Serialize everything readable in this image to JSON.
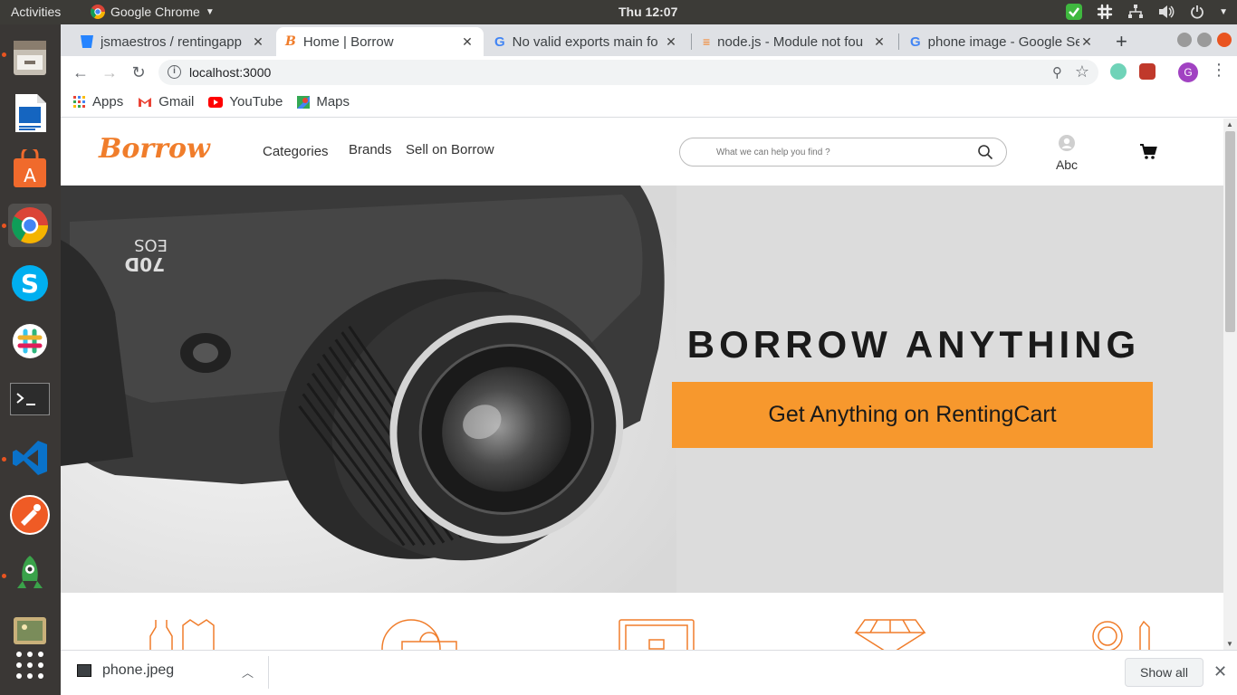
{
  "system": {
    "activities": "Activities",
    "app_name": "Google Chrome",
    "clock": "Thu 12:07"
  },
  "tabs": [
    {
      "title": "jsmaestros / rentingapp",
      "active": false
    },
    {
      "title": "Home | Borrow",
      "active": true
    },
    {
      "title": "No valid exports main fo",
      "active": false
    },
    {
      "title": "node.js - Module not fou",
      "active": false
    },
    {
      "title": "phone image - Google Se",
      "active": false
    }
  ],
  "toolbar": {
    "url": "localhost:3000"
  },
  "bookmarks": [
    {
      "label": "Apps",
      "icon": "apps-grid-icon"
    },
    {
      "label": "Gmail",
      "icon": "gmail-icon"
    },
    {
      "label": "YouTube",
      "icon": "youtube-icon"
    },
    {
      "label": "Maps",
      "icon": "maps-icon"
    }
  ],
  "site": {
    "logo": "Borrow",
    "nav": [
      "Categories",
      "Brands",
      "Sell on Borrow"
    ],
    "search_placeholder": "What we can help you find ?",
    "user_name": "Abc",
    "hero_title": "BORROW ANYTHING",
    "cta_label": "Get Anything on RentingCart",
    "brand_color": "#f07d2b",
    "cta_color": "#f7982d"
  },
  "camera_text": {
    "model_line1": "EOS",
    "model_line2": "70D"
  },
  "downloads": {
    "file_name": "phone.jpeg",
    "show_all": "Show all"
  }
}
